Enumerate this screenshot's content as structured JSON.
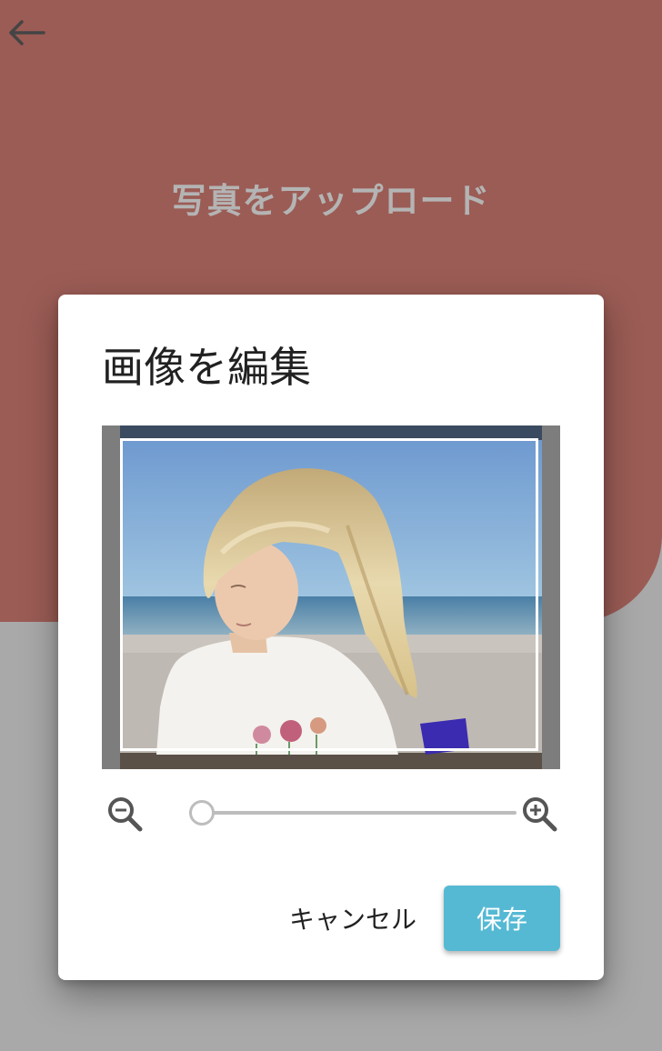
{
  "page": {
    "title": "写真をアップロード",
    "back_icon": "arrow-left-icon"
  },
  "dialog": {
    "title": "画像を編集",
    "image_alt": "girl-on-beach-photo",
    "zoom": {
      "zoom_out_icon": "zoom-out-icon",
      "zoom_in_icon": "zoom-in-icon",
      "level": 0.0
    },
    "cancel_label": "キャンセル",
    "save_label": "保存"
  },
  "colors": {
    "header_bg": "#9b5c55",
    "overlay_gray": "#a9a9a9",
    "save_button": "#55b9d4"
  }
}
